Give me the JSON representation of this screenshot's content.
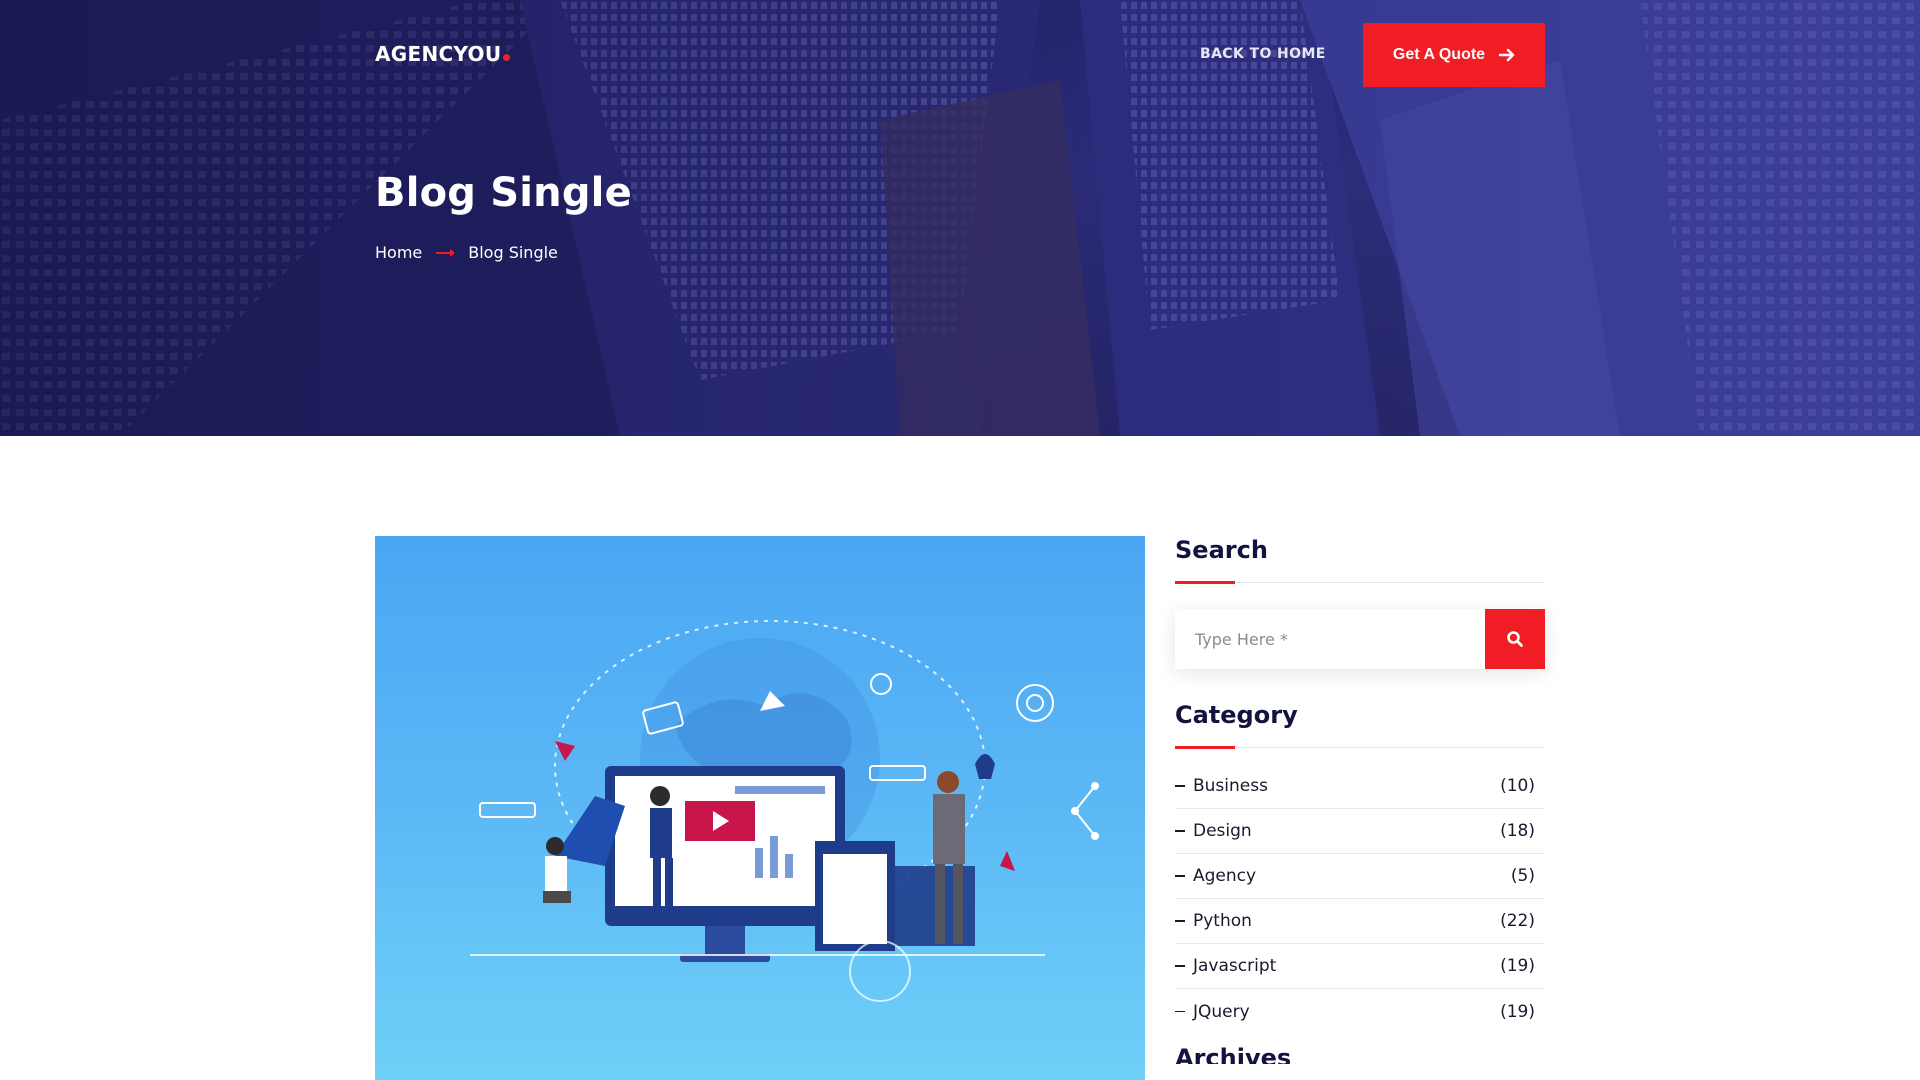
{
  "header": {
    "logo_text": "AGENCYOU",
    "back_label": "BACK TO HOME",
    "quote_label": "Get A Quote",
    "quote_icon": "arrow-right-icon"
  },
  "hero": {
    "title": "Blog Single",
    "breadcrumb": [
      "Home",
      "Blog Single"
    ]
  },
  "sidebar": {
    "search": {
      "title": "Search",
      "placeholder": "Type Here *",
      "button_icon": "search-icon"
    },
    "category": {
      "title": "Category",
      "items": [
        {
          "label": "Business",
          "count": "(10)"
        },
        {
          "label": "Design",
          "count": "(18)"
        },
        {
          "label": "Agency",
          "count": "(5)"
        },
        {
          "label": "Python",
          "count": "(22)"
        },
        {
          "label": "Javascript",
          "count": "(19)"
        },
        {
          "label": "JQuery",
          "count": "(19)"
        }
      ]
    },
    "next_widget_title": "Archives"
  },
  "colors": {
    "accent": "#f01d24",
    "hero_navy": "#2b2c78",
    "heading": "#12133f"
  }
}
